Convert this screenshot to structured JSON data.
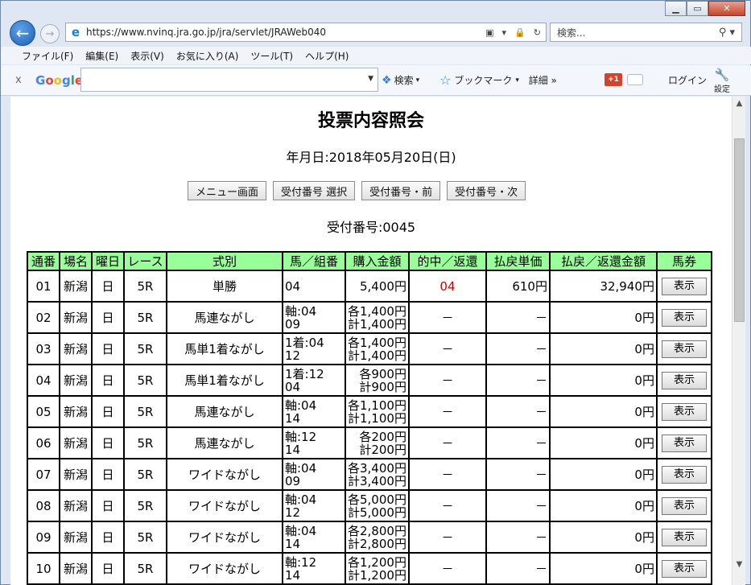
{
  "browser": {
    "url": "https://www.nvinq.jra.go.jp/jra/servlet/JRAWeb040",
    "search_placeholder": "検索...",
    "menu": [
      "ファイル(F)",
      "編集(E)",
      "表示(V)",
      "お気に入り(A)",
      "ツール(T)",
      "ヘルプ(H)"
    ],
    "google_toolbar": {
      "close": "x",
      "logo": "Google",
      "search_label": "検索",
      "bookmark_label": "ブックマーク",
      "detail_label": "詳細 »",
      "gplus": "+1",
      "login_label": "ログイン",
      "settings_label": "設定"
    }
  },
  "page": {
    "title": "投票内容照会",
    "date_line": "年月日:2018年05月20日(日)",
    "buttons": [
      "メニュー画面",
      "受付番号 選択",
      "受付番号・前",
      "受付番号・次"
    ],
    "receipt_number": "受付番号:0045"
  },
  "table": {
    "headers": [
      "通番",
      "場名",
      "曜日",
      "レース",
      "式別",
      "馬／組番",
      "購入金額",
      "的中／返還",
      "払戻単価",
      "払戻／返還金額",
      "馬券"
    ],
    "show_label": "表示",
    "rows": [
      {
        "no": "01",
        "venue": "新潟",
        "day": "日",
        "race": "5R",
        "type": "単勝",
        "combo1": "04",
        "combo2": "",
        "amt1": "5,400円",
        "amt2": "",
        "hit": "04",
        "unit": "610円",
        "payout": "32,940円"
      },
      {
        "no": "02",
        "venue": "新潟",
        "day": "日",
        "race": "5R",
        "type": "馬連ながし",
        "combo1": "軸:04",
        "combo2": "09",
        "amt1": "各1,400円",
        "amt2": "計1,400円",
        "hit": "－",
        "unit": "－",
        "payout": "0円"
      },
      {
        "no": "03",
        "venue": "新潟",
        "day": "日",
        "race": "5R",
        "type": "馬単1着ながし",
        "combo1": "1着:04",
        "combo2": "12",
        "amt1": "各1,400円",
        "amt2": "計1,400円",
        "hit": "－",
        "unit": "－",
        "payout": "0円"
      },
      {
        "no": "04",
        "venue": "新潟",
        "day": "日",
        "race": "5R",
        "type": "馬単1着ながし",
        "combo1": "1着:12",
        "combo2": "04",
        "amt1": "各900円",
        "amt2": "計900円",
        "hit": "－",
        "unit": "－",
        "payout": "0円"
      },
      {
        "no": "05",
        "venue": "新潟",
        "day": "日",
        "race": "5R",
        "type": "馬連ながし",
        "combo1": "軸:04",
        "combo2": "14",
        "amt1": "各1,100円",
        "amt2": "計1,100円",
        "hit": "－",
        "unit": "－",
        "payout": "0円"
      },
      {
        "no": "06",
        "venue": "新潟",
        "day": "日",
        "race": "5R",
        "type": "馬連ながし",
        "combo1": "軸:12",
        "combo2": "14",
        "amt1": "各200円",
        "amt2": "計200円",
        "hit": "－",
        "unit": "－",
        "payout": "0円"
      },
      {
        "no": "07",
        "venue": "新潟",
        "day": "日",
        "race": "5R",
        "type": "ワイドながし",
        "combo1": "軸:04",
        "combo2": "09",
        "amt1": "各3,400円",
        "amt2": "計3,400円",
        "hit": "－",
        "unit": "－",
        "payout": "0円"
      },
      {
        "no": "08",
        "venue": "新潟",
        "day": "日",
        "race": "5R",
        "type": "ワイドながし",
        "combo1": "軸:04",
        "combo2": "12",
        "amt1": "各5,000円",
        "amt2": "計5,000円",
        "hit": "－",
        "unit": "－",
        "payout": "0円"
      },
      {
        "no": "09",
        "venue": "新潟",
        "day": "日",
        "race": "5R",
        "type": "ワイドながし",
        "combo1": "軸:04",
        "combo2": "14",
        "amt1": "各2,800円",
        "amt2": "計2,800円",
        "hit": "－",
        "unit": "－",
        "payout": "0円"
      },
      {
        "no": "10",
        "venue": "新潟",
        "day": "日",
        "race": "5R",
        "type": "ワイドながし",
        "combo1": "軸:12",
        "combo2": "14",
        "amt1": "各1,200円",
        "amt2": "計1,200円",
        "hit": "－",
        "unit": "－",
        "payout": "0円"
      }
    ]
  }
}
